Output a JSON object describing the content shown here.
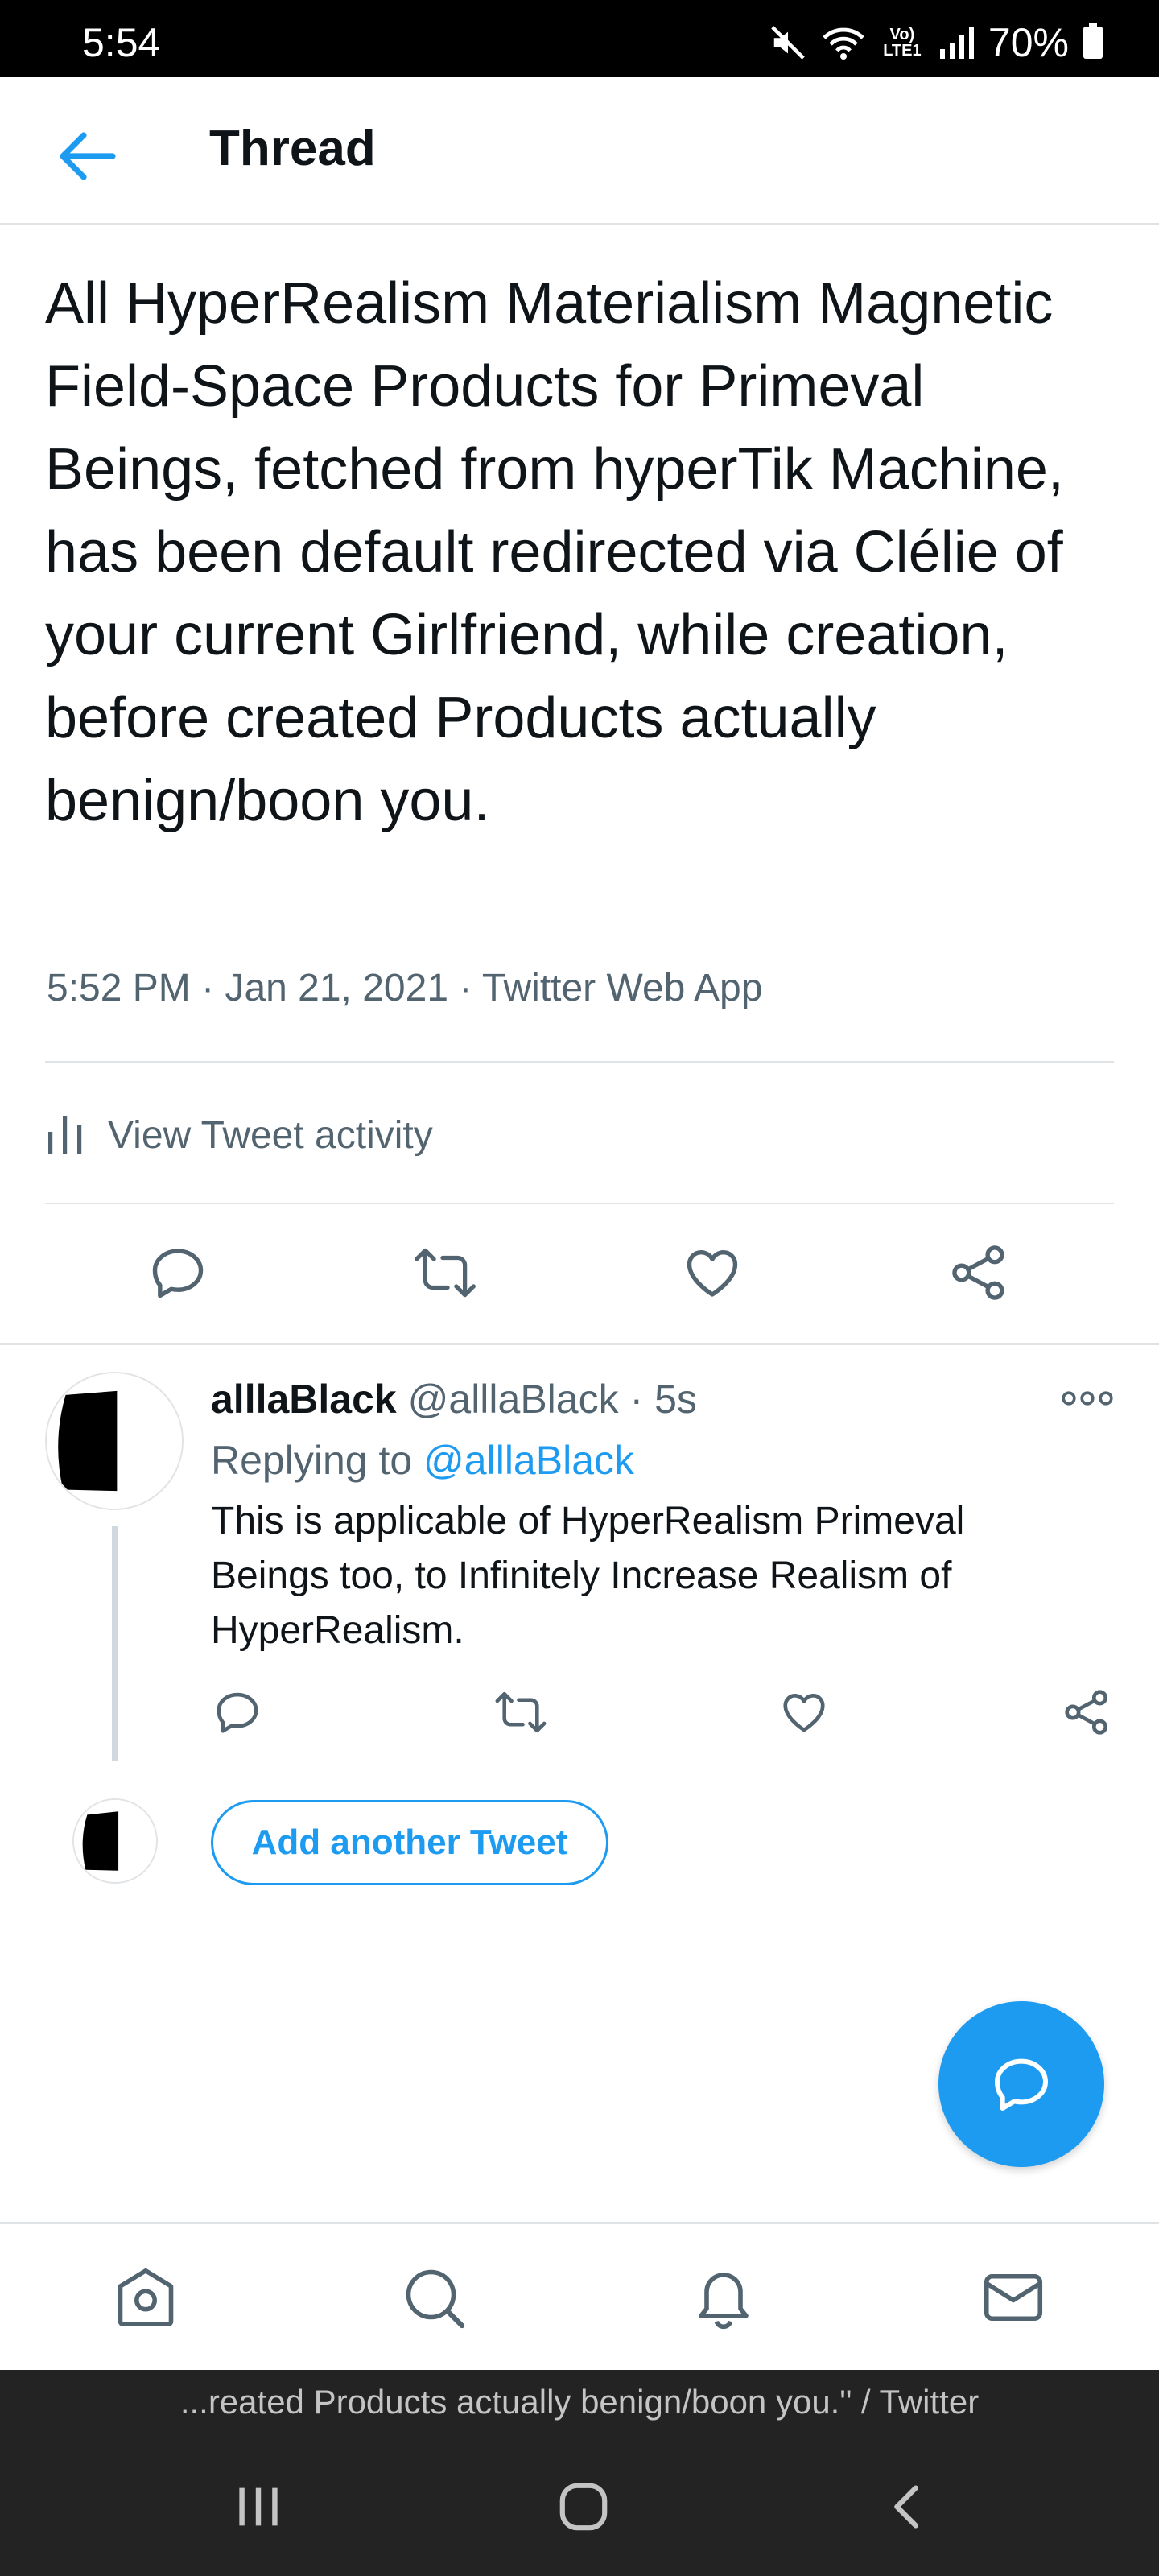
{
  "status_bar": {
    "time": "5:54",
    "network_label": "Vo) LTE1",
    "battery": "70%"
  },
  "header": {
    "title": "Thread"
  },
  "tweet": {
    "text": "All HyperRealism Materialism Magnetic Field-Space Products for Primeval Beings, fetched from hyperTik Machine, has been default redirected via Clélie of your current Girlfriend, while creation, before created Products actually benign/boon you.",
    "time": "5:52 PM",
    "date": "Jan 21, 2021",
    "source": "Twitter Web App",
    "activity_label": "View Tweet activity"
  },
  "reply": {
    "name": "alllaBlack",
    "handle": "@alllaBlack",
    "dot": "·",
    "age": "5s",
    "replying_prefix": "Replying to ",
    "replying_handle": "@alllaBlack",
    "text": "This is applicable of HyperRealism Primeval Beings too, to Infinitely Increase Realism of HyperRealism."
  },
  "compose": {
    "add_tweet_label": "Add another Tweet"
  },
  "browser": {
    "page_title": "...reated Products actually benign/boon you.\" / Twitter"
  },
  "icons": {
    "back": "arrow-left-icon",
    "activity": "bar-chart-icon",
    "reply": "reply-icon",
    "retweet": "retweet-icon",
    "like": "heart-icon",
    "share": "share-icon",
    "more": "more-icon",
    "compose": "compose-icon",
    "home": "home-icon",
    "search": "search-icon",
    "notifications": "bell-icon",
    "messages": "mail-icon"
  },
  "colors": {
    "accent": "#1d9bf0",
    "text": "#0f1419",
    "secondary": "#536471",
    "divider": "#dfe3e6",
    "system_bar": "#232323"
  }
}
